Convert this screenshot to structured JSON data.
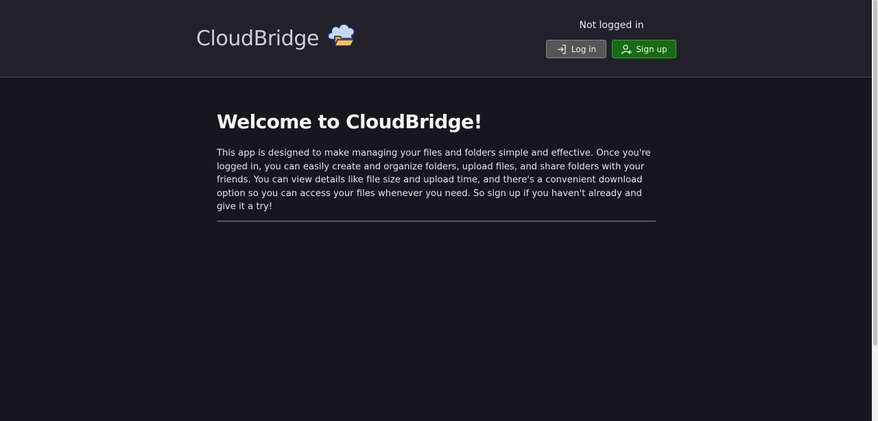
{
  "header": {
    "brand": "CloudBridge",
    "logo_icon": "cloud-folder-icon",
    "auth": {
      "status": "Not logged in",
      "login_label": "Log in",
      "login_icon": "login-arrow-icon",
      "signup_label": "Sign up",
      "signup_icon": "user-plus-icon"
    }
  },
  "main": {
    "title": "Welcome to CloudBridge!",
    "intro": "This app is designed to make managing your files and folders simple and effective. Once you're logged in, you can easily create and organize folders, upload files, and share folders with your friends. You can view details like file size and upload time, and there's a convenient download option so you can access your files whenever you need. So sign up if you haven't already and give it a try!"
  },
  "colors": {
    "header_bg": "#222129",
    "page_bg": "#17161c",
    "login_button": "#565659",
    "signup_button": "#176b12"
  }
}
